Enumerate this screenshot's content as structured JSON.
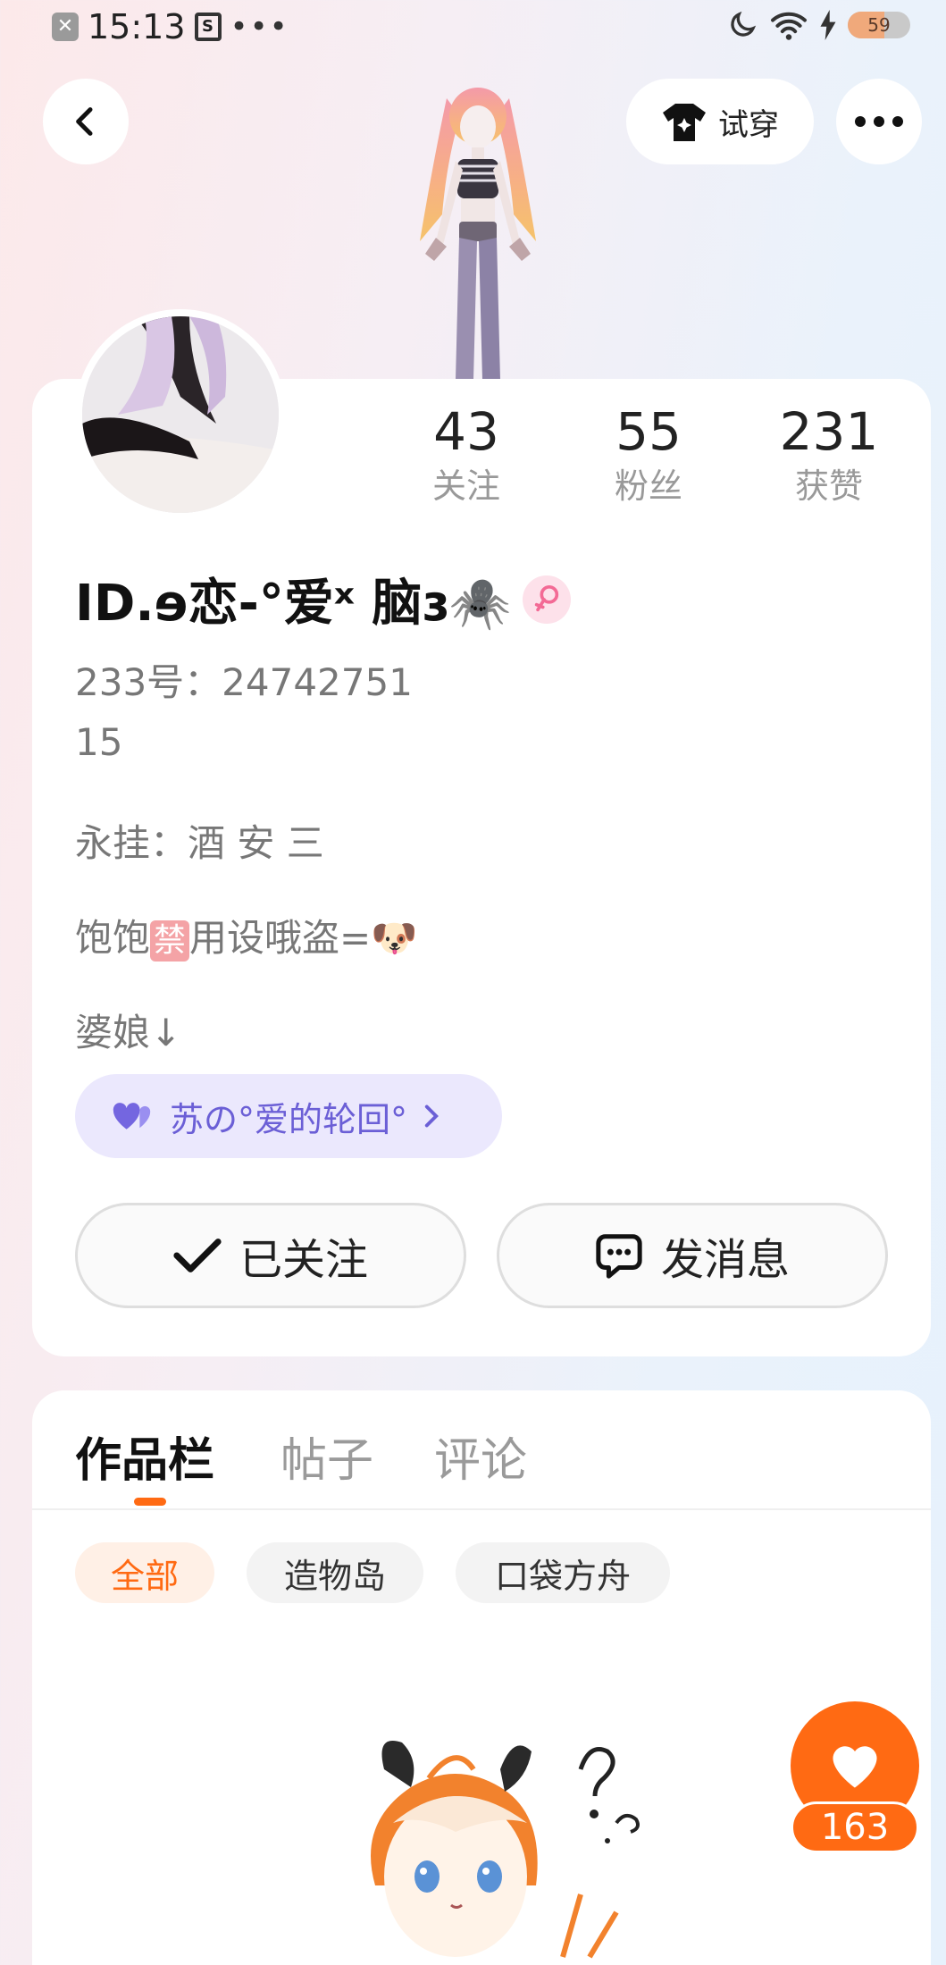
{
  "status_bar": {
    "time": "15:13",
    "dots": "•••",
    "battery": "59",
    "battery_level": 0.59
  },
  "header": {
    "tryon_label": "试穿"
  },
  "icons": {
    "back": "back-arrow-icon",
    "tshirt": "tshirt-icon",
    "more": "more-dots-icon",
    "check": "check-icon",
    "message": "message-bubble-icon",
    "heart": "heart-icon",
    "chevron": "chevron-right-icon"
  },
  "profile": {
    "name": "ID.ɘ恋-°爱ˣ 脑ɜ🕷️",
    "id_line": "233号：24742751",
    "age": "15",
    "bio_line1": "永挂：酒 安 三",
    "bio_line2_before": "饱饱",
    "bio_line2_badge": "禁",
    "bio_line2_after": "用设哦盗=🐶",
    "bio_line3": "婆娘↓",
    "couple_label": "苏の°爱的轮回°"
  },
  "stats": [
    {
      "value": "43",
      "label": "关注"
    },
    {
      "value": "55",
      "label": "粉丝"
    },
    {
      "value": "231",
      "label": "获赞"
    }
  ],
  "actions": {
    "follow_label": "已关注",
    "message_label": "发消息"
  },
  "tabs": [
    {
      "label": "作品栏",
      "active": true
    },
    {
      "label": "帖子",
      "active": false
    },
    {
      "label": "评论",
      "active": false
    }
  ],
  "filters": [
    {
      "label": "全部",
      "active": true
    },
    {
      "label": "造物岛",
      "active": false
    },
    {
      "label": "口袋方舟",
      "active": false
    }
  ],
  "work": {
    "like_count": "163"
  },
  "colors": {
    "accent": "#ff6a13",
    "couple_text": "#6b5fd6",
    "couple_bg": "#ebe8fd"
  }
}
